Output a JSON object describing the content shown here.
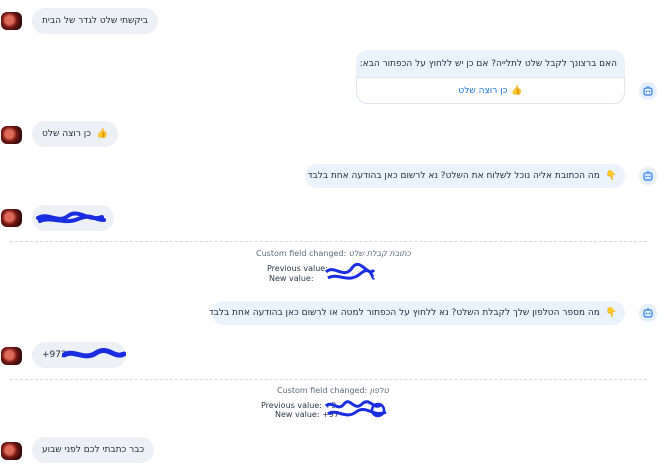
{
  "messages": {
    "m1": "ביקשתי שלט לגדר של הבית",
    "m2_question": "האם ברצונך לקבל שלט לתלייה? אם כן יש ללחוץ על הכפתור הבא:",
    "m2_button": "כן רוצה שלט",
    "m3": "כן רוצה שלט",
    "m4": "מה הכתובת אליה נוכל לשלוח את השלט? נא לרשום כאן בהודעה אחת בלבד",
    "m5_phone": "+972",
    "m6": "מה מספר הטלפון שלך לקבלת השלט? נא ללחוץ על הכפתור למטה או לרשום כאן בהודעה אחת בלבד",
    "m7": "כבר כתבתי לכם לפני שבוע"
  },
  "custom_field_1": {
    "label": "Custom field changed:",
    "field_name": "כתובת קבלת שלט",
    "previous_label": "Previous value:",
    "new_label": "New value:"
  },
  "custom_field_2": {
    "label": "Custom field changed:",
    "field_name": "טלפון",
    "previous_label": "Previous value:",
    "previous_value": "+9",
    "new_label": "New value:",
    "new_value": "+97"
  },
  "icons": {
    "thumbs_up": "👍",
    "pointing_down": "👇"
  },
  "colors": {
    "bubble_left": "#edf0f5",
    "bubble_right": "#eaf2fc",
    "link": "#1a73e8",
    "redaction": "#1a2de0"
  }
}
